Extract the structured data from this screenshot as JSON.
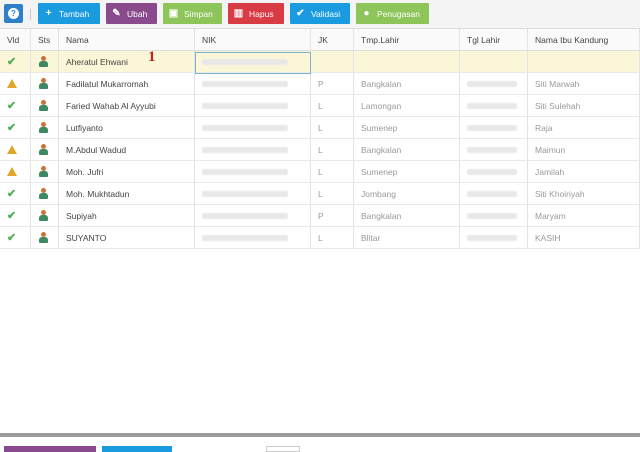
{
  "toolbar": {
    "buttons": [
      {
        "label": "Tambah",
        "icon": "plus-icon",
        "color": "#1a9be0"
      },
      {
        "label": "Ubah",
        "icon": "pencil-icon",
        "color": "#8a4b8e"
      },
      {
        "label": "Simpan",
        "icon": "save-icon",
        "color": "#8dc55a"
      },
      {
        "label": "Hapus",
        "icon": "trash-icon",
        "color": "#d93b45"
      },
      {
        "label": "Validasi",
        "icon": "check-icon",
        "color": "#1a9be0"
      },
      {
        "label": "Penugasan",
        "icon": "user-icon",
        "color": "#8dc55a"
      }
    ],
    "help_icon": "question-icon"
  },
  "grid": {
    "columns": [
      "Vld",
      "Sts",
      "Nama",
      "NIK",
      "JK",
      "Tmp.Lahir",
      "Tgl Lahir",
      "Nama Ibu Kandung"
    ],
    "rows": [
      {
        "vld": "check",
        "nama": "Aheratul Ehwani",
        "jk": "",
        "tmp": "",
        "ibu": ""
      },
      {
        "vld": "warn",
        "nama": "Fadilatul Mukarromah",
        "jk": "P",
        "tmp": "Bangkalan",
        "ibu": "Siti Marwah"
      },
      {
        "vld": "check",
        "nama": "Faried Wahab Al Ayyubi",
        "jk": "L",
        "tmp": "Lamongan",
        "ibu": "Siti Sulehah"
      },
      {
        "vld": "check",
        "nama": "Lutfiyanto",
        "jk": "L",
        "tmp": "Sumenep",
        "ibu": "Raja"
      },
      {
        "vld": "warn",
        "nama": "M.Abdul Wadud",
        "jk": "L",
        "tmp": "Bangkalan",
        "ibu": "Maimun"
      },
      {
        "vld": "warn",
        "nama": "Moh. Jufri",
        "jk": "L",
        "tmp": "Sumenep",
        "ibu": "Jamilah"
      },
      {
        "vld": "check",
        "nama": "Moh. Mukhtadun",
        "jk": "L",
        "tmp": "Jombang",
        "ibu": "Siti Khoiriyah"
      },
      {
        "vld": "check",
        "nama": "Supiyah",
        "jk": "P",
        "tmp": "Bangkalan",
        "ibu": "Maryam"
      },
      {
        "vld": "check",
        "nama": "SUYANTO",
        "jk": "L",
        "tmp": "Blitar",
        "ibu": "KASIH"
      }
    ]
  },
  "annotation": {
    "marker": "1"
  },
  "colors": {
    "selected_row": "#fcf6d8",
    "valid": "#4caf50",
    "warning": "#e0a52a"
  }
}
